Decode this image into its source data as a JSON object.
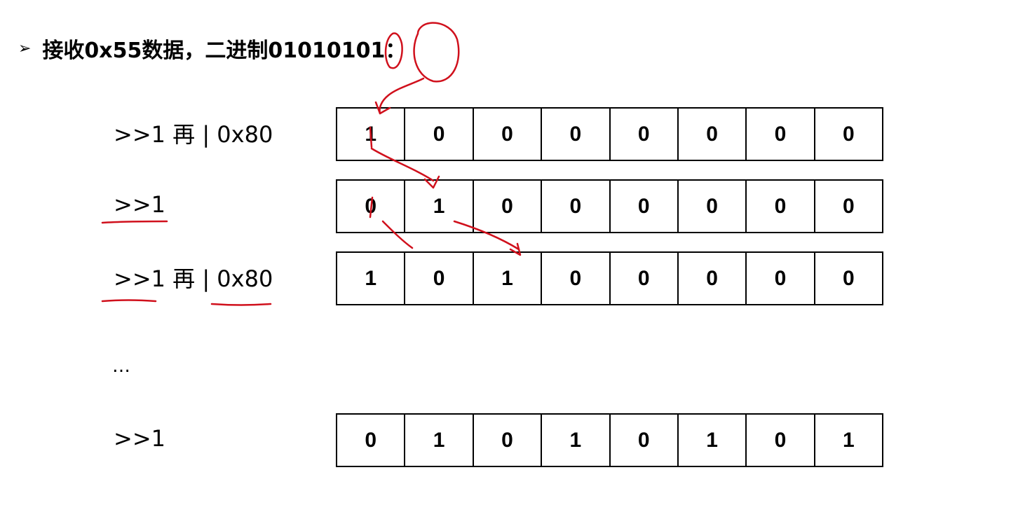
{
  "header": {
    "bullet_icon": "arrow-bullet-icon",
    "bullet_glyph": "➢",
    "title": "接收0x55数据，二进制01010101："
  },
  "steps": [
    {
      "label": ">>1 再 | 0x80",
      "bits": [
        "1",
        "0",
        "0",
        "0",
        "0",
        "0",
        "0",
        "0"
      ]
    },
    {
      "label": ">>1",
      "bits": [
        "0",
        "1",
        "0",
        "0",
        "0",
        "0",
        "0",
        "0"
      ]
    },
    {
      "label": ">>1 再 | 0x80",
      "bits": [
        "1",
        "0",
        "1",
        "0",
        "0",
        "0",
        "0",
        "0"
      ]
    }
  ],
  "ellipsis": "…",
  "final_step": {
    "label": ">>1",
    "bits": [
      "0",
      "1",
      "0",
      "1",
      "0",
      "1",
      "0",
      "1"
    ]
  },
  "colors": {
    "ink": "#000000",
    "annotation": "#d0101c",
    "background": "#ffffff"
  }
}
